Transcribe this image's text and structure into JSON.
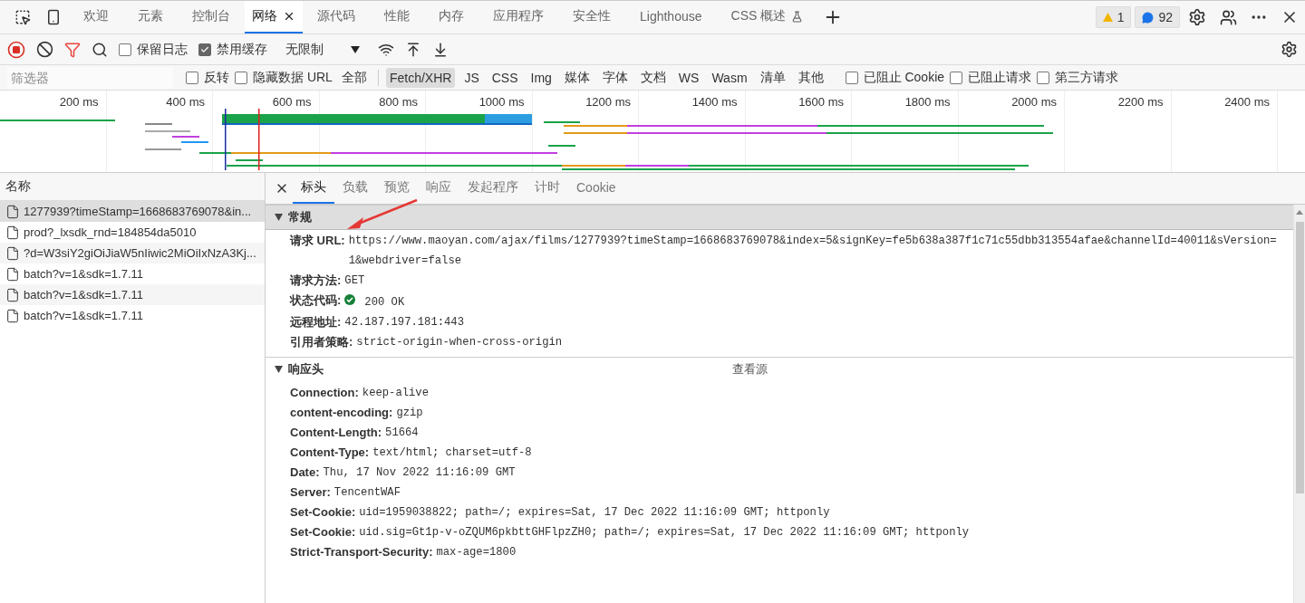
{
  "tabs": [
    {
      "label": "欢迎",
      "selected": false,
      "experimental": false
    },
    {
      "label": "元素",
      "selected": false,
      "experimental": false
    },
    {
      "label": "控制台",
      "selected": false,
      "experimental": false
    },
    {
      "label": "网络",
      "selected": true,
      "experimental": false
    },
    {
      "label": "源代码",
      "selected": false,
      "experimental": false
    },
    {
      "label": "性能",
      "selected": false,
      "experimental": false
    },
    {
      "label": "内存",
      "selected": false,
      "experimental": false
    },
    {
      "label": "应用程序",
      "selected": false,
      "experimental": false
    },
    {
      "label": "安全性",
      "selected": false,
      "experimental": false
    },
    {
      "label": "Lighthouse",
      "selected": false,
      "experimental": false
    },
    {
      "label": "CSS 概述",
      "selected": false,
      "experimental": true
    }
  ],
  "badges": {
    "warnings": "1",
    "messages": "92"
  },
  "toolbar": {
    "preserve_log": {
      "label": "保留日志",
      "checked": false
    },
    "disable_cache": {
      "label": "禁用缓存",
      "checked": true
    },
    "throttling": "无限制"
  },
  "filter_bar": {
    "placeholder": "筛选器",
    "checks_before": [
      {
        "label": "反转",
        "checked": false
      },
      {
        "label": "隐藏数据 URL",
        "checked": false
      }
    ],
    "types": [
      {
        "label": "全部",
        "selected": false
      },
      {
        "label": "Fetch/XHR",
        "selected": true
      },
      {
        "label": "JS",
        "selected": false
      },
      {
        "label": "CSS",
        "selected": false
      },
      {
        "label": "Img",
        "selected": false
      },
      {
        "label": "媒体",
        "selected": false
      },
      {
        "label": "字体",
        "selected": false
      },
      {
        "label": "文档",
        "selected": false
      },
      {
        "label": "WS",
        "selected": false
      },
      {
        "label": "Wasm",
        "selected": false
      },
      {
        "label": "清单",
        "selected": false
      },
      {
        "label": "其他",
        "selected": false
      }
    ],
    "checks_after": [
      {
        "label": "已阻止 Cookie",
        "checked": false
      },
      {
        "label": "已阻止请求",
        "checked": false
      },
      {
        "label": "第三方请求",
        "checked": false
      }
    ]
  },
  "timeline": {
    "ticks": [
      "200 ms",
      "400 ms",
      "600 ms",
      "800 ms",
      "1000 ms",
      "1200 ms",
      "1400 ms",
      "1600 ms",
      "1800 ms",
      "2000 ms",
      "2200 ms",
      "2400 ms"
    ]
  },
  "requests": {
    "column": "名称",
    "rows": [
      {
        "name": "1277939?timeStamp=1668683769078&in...",
        "selected": true
      },
      {
        "name": "prod?_lxsdk_rnd=184854da5010",
        "selected": false
      },
      {
        "name": "?d=W3siY2giOiJiaW5nIiwic2MiOiIxNzA3Kj...",
        "selected": false
      },
      {
        "name": "batch?v=1&sdk=1.7.11",
        "selected": false
      },
      {
        "name": "batch?v=1&sdk=1.7.11",
        "selected": false
      },
      {
        "name": "batch?v=1&sdk=1.7.11",
        "selected": false
      }
    ]
  },
  "detail_tabs": [
    {
      "label": "标头",
      "selected": true
    },
    {
      "label": "负载",
      "selected": false
    },
    {
      "label": "预览",
      "selected": false
    },
    {
      "label": "响应",
      "selected": false
    },
    {
      "label": "发起程序",
      "selected": false
    },
    {
      "label": "计时",
      "selected": false
    },
    {
      "label": "Cookie",
      "selected": false
    }
  ],
  "sections": [
    {
      "title": "常规",
      "expanded": true,
      "rows": [
        {
          "kind": "text",
          "name": "请求 URL:",
          "value": "https://www.maoyan.com/ajax/films/1277939?timeStamp=1668683769078&index=5&signKey=fe5b638a387f1c71c55dbb313554afae&channelId=40011&sVersion=1&webdriver=false"
        },
        {
          "kind": "text",
          "name": "请求方法:",
          "value": "GET"
        },
        {
          "kind": "status",
          "name": "状态代码:",
          "value": "200 OK"
        },
        {
          "kind": "text",
          "name": "远程地址:",
          "value": "42.187.197.181:443"
        },
        {
          "kind": "text",
          "name": "引用者策略:",
          "value": "strict-origin-when-cross-origin"
        }
      ]
    },
    {
      "title": "响应头",
      "expanded": true,
      "action": "查看源",
      "rows": [
        {
          "kind": "text",
          "name": "Connection:",
          "value": "keep-alive"
        },
        {
          "kind": "text",
          "name": "content-encoding:",
          "value": "gzip"
        },
        {
          "kind": "text",
          "name": "Content-Length:",
          "value": "51664"
        },
        {
          "kind": "text",
          "name": "Content-Type:",
          "value": "text/html; charset=utf-8"
        },
        {
          "kind": "text",
          "name": "Date:",
          "value": "Thu, 17 Nov 2022 11:16:09 GMT"
        },
        {
          "kind": "text",
          "name": "Server:",
          "value": "TencentWAF"
        },
        {
          "kind": "text",
          "name": "Set-Cookie:",
          "value": "uid=1959038822; path=/; expires=Sat, 17 Dec 2022 11:16:09 GMT; httponly"
        },
        {
          "kind": "text",
          "name": "Set-Cookie:",
          "value": "uid.sig=Gt1p-v-oZQUM6pkbttGHFlpzZH0; path=/; expires=Sat, 17 Dec 2022 11:16:09 GMT; httponly"
        },
        {
          "kind": "text",
          "name": "Strict-Transport-Security:",
          "value": "max-age=1800"
        }
      ]
    }
  ]
}
